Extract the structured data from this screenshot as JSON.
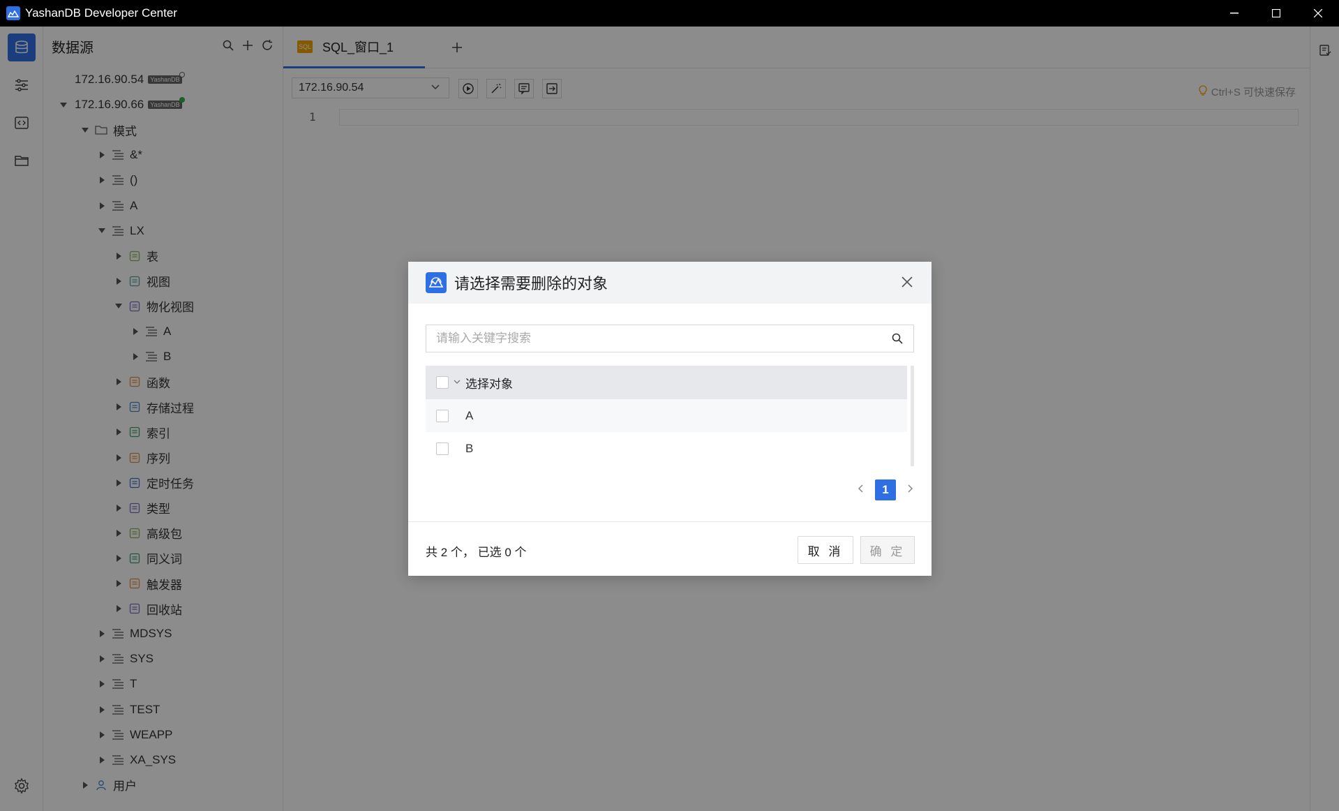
{
  "window": {
    "title": "YashanDB Developer Center",
    "colors": {
      "accent": "#2f6fe4",
      "titlebar": "#000000"
    }
  },
  "activity_bar": {
    "items": [
      {
        "icon": "database-icon",
        "active": true
      },
      {
        "icon": "sliders-icon",
        "active": false
      },
      {
        "icon": "code-icon",
        "active": false
      },
      {
        "icon": "folder-icon",
        "active": false
      }
    ],
    "bottom": {
      "icon": "gear-icon"
    }
  },
  "sidebar": {
    "title": "数据源",
    "tools": [
      "search-icon",
      "plus-icon",
      "refresh-icon"
    ],
    "tree": [
      {
        "label": "172.16.90.54",
        "tag": "YashanDB",
        "status": "offline",
        "level": 0,
        "state": "none",
        "icon": ""
      },
      {
        "label": "172.16.90.66",
        "tag": "YashanDB",
        "status": "online",
        "level": 0,
        "state": "open",
        "icon": ""
      },
      {
        "label": "模式",
        "level": 1,
        "state": "open",
        "icon": "folder-icon"
      },
      {
        "label": "&*",
        "level": 2,
        "state": "closed",
        "icon": "schema-icon"
      },
      {
        "label": "()",
        "level": 2,
        "state": "closed",
        "icon": "schema-icon"
      },
      {
        "label": "A",
        "level": 2,
        "state": "closed",
        "icon": "schema-icon"
      },
      {
        "label": "LX",
        "level": 2,
        "state": "open",
        "icon": "schema-icon"
      },
      {
        "label": "表",
        "level": 3,
        "state": "closed",
        "icon": "table-icon"
      },
      {
        "label": "视图",
        "level": 3,
        "state": "closed",
        "icon": "view-icon"
      },
      {
        "label": "物化视图",
        "level": 3,
        "state": "open",
        "icon": "materialized-view-icon"
      },
      {
        "label": "A",
        "level": 4,
        "state": "closed",
        "icon": "schema-icon"
      },
      {
        "label": "B",
        "level": 4,
        "state": "closed",
        "icon": "schema-icon"
      },
      {
        "label": "函数",
        "level": 3,
        "state": "closed",
        "icon": "function-icon"
      },
      {
        "label": "存储过程",
        "level": 3,
        "state": "closed",
        "icon": "procedure-icon"
      },
      {
        "label": "索引",
        "level": 3,
        "state": "closed",
        "icon": "index-icon"
      },
      {
        "label": "序列",
        "level": 3,
        "state": "closed",
        "icon": "sequence-icon"
      },
      {
        "label": "定时任务",
        "level": 3,
        "state": "closed",
        "icon": "scheduled-job-icon"
      },
      {
        "label": "类型",
        "level": 3,
        "state": "closed",
        "icon": "type-icon"
      },
      {
        "label": "高级包",
        "level": 3,
        "state": "closed",
        "icon": "package-icon"
      },
      {
        "label": "同义词",
        "level": 3,
        "state": "closed",
        "icon": "synonym-icon"
      },
      {
        "label": "触发器",
        "level": 3,
        "state": "closed",
        "icon": "trigger-icon"
      },
      {
        "label": "回收站",
        "level": 3,
        "state": "closed",
        "icon": "recycle-bin-icon"
      },
      {
        "label": "MDSYS",
        "level": 2,
        "state": "closed",
        "icon": "schema-icon"
      },
      {
        "label": "SYS",
        "level": 2,
        "state": "closed",
        "icon": "schema-icon"
      },
      {
        "label": "T",
        "level": 2,
        "state": "closed",
        "icon": "schema-icon"
      },
      {
        "label": "TEST",
        "level": 2,
        "state": "closed",
        "icon": "schema-icon"
      },
      {
        "label": "WEAPP",
        "level": 2,
        "state": "closed",
        "icon": "schema-icon"
      },
      {
        "label": "XA_SYS",
        "level": 2,
        "state": "closed",
        "icon": "schema-icon"
      },
      {
        "label": "用户",
        "level": 1,
        "state": "closed",
        "icon": "user-icon"
      }
    ]
  },
  "editor": {
    "tab": {
      "label": "SQL_窗口_1",
      "icon_text": "SQL"
    },
    "connection": "172.16.90.54",
    "save_hint": "Ctrl+S 可快速保存",
    "line_number": "1"
  },
  "dialog": {
    "title": "请选择需要删除的对象",
    "search_placeholder": "请输入关键字搜索",
    "table_header": "选择对象",
    "rows": [
      "A",
      "B"
    ],
    "page": "1",
    "summary": "共 2 个， 已选 0 个",
    "cancel_label": "取 消",
    "ok_label": "确 定"
  }
}
